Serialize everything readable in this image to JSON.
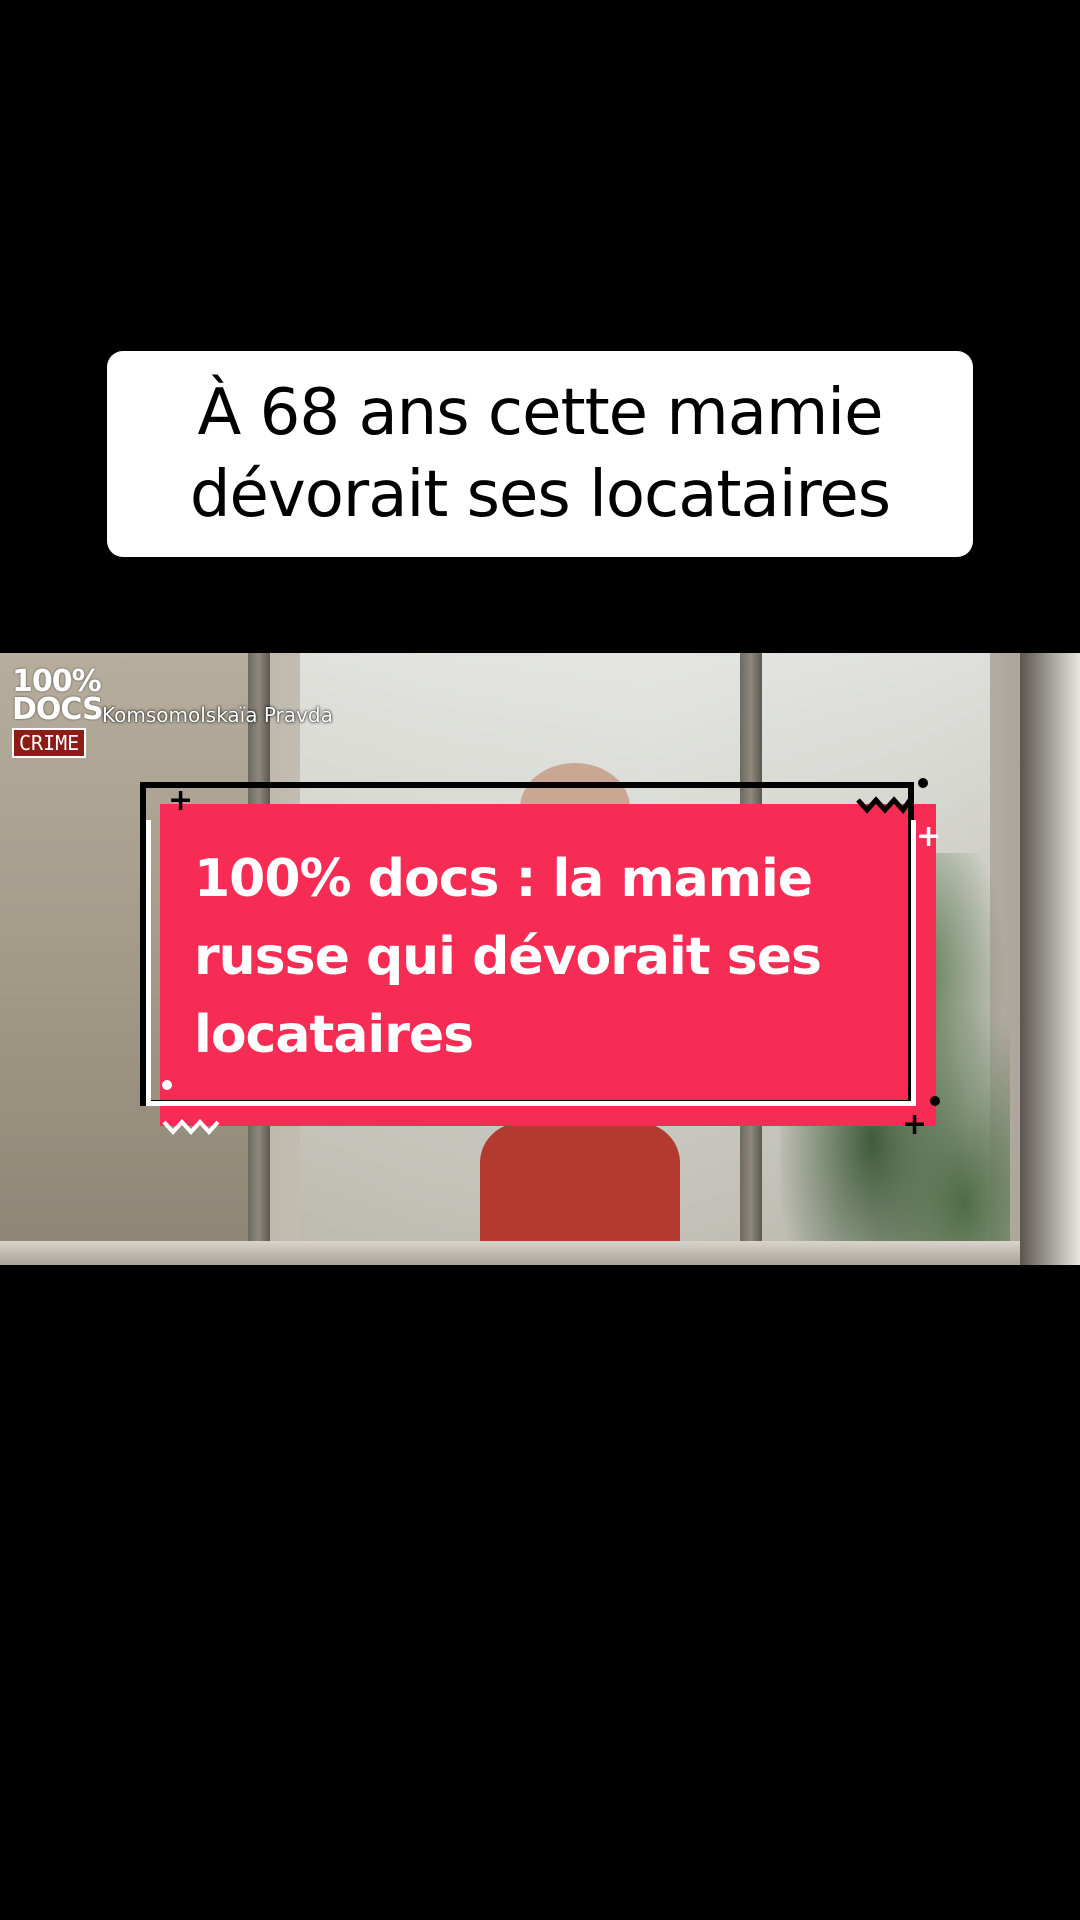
{
  "caption": {
    "line1": "À 68 ans cette mamie",
    "line2": "dévorait ses locataires"
  },
  "video": {
    "logo": {
      "line1": "100%",
      "line2": "DOCS",
      "badge": "CRIME"
    },
    "source_credit": "Komsomolskaïa Pravda"
  },
  "title_card": {
    "line1": "100% docs : la mamie",
    "line2": "russe qui dévorait ses",
    "line3": "locataires"
  },
  "colors": {
    "card_red": "#f72c54",
    "logo_badge_red": "#8c1c16",
    "background": "#000000"
  }
}
